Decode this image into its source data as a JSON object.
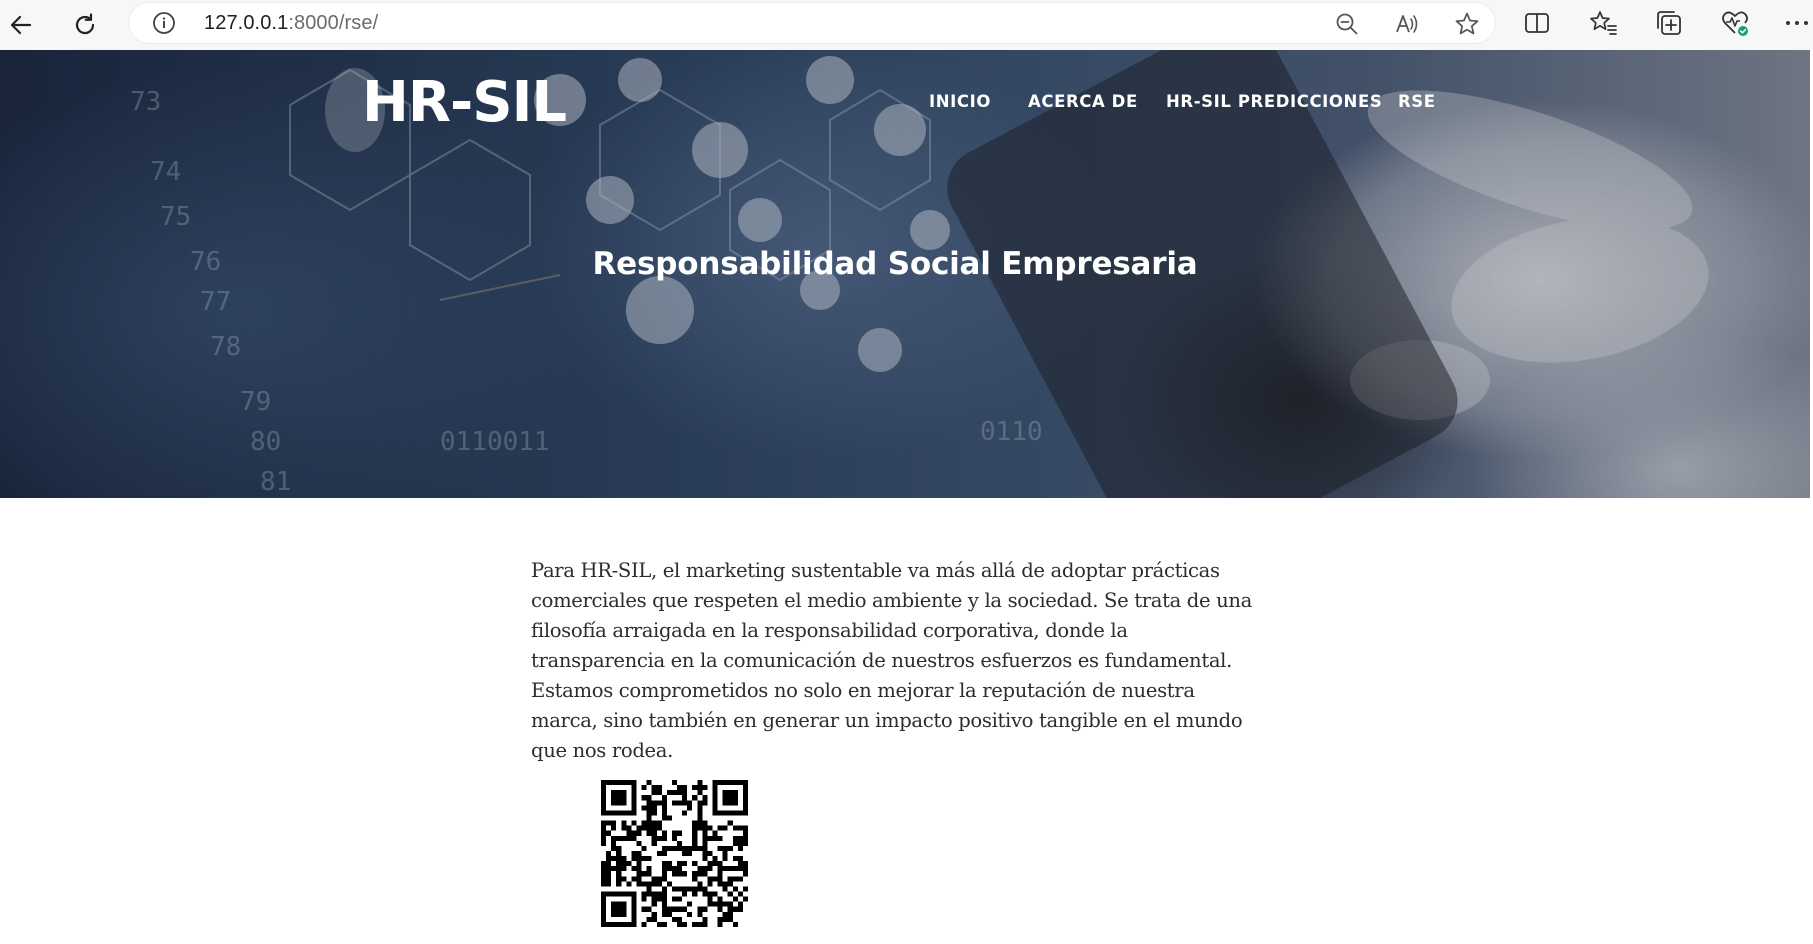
{
  "browser": {
    "url_host": "127.0.0.1",
    "url_path": ":8000/rse/",
    "icons": [
      "back-icon",
      "refresh-icon",
      "info-icon",
      "zoom-out-icon",
      "read-aloud-icon",
      "favorite-star-icon",
      "split-screen-icon",
      "favorites-icon",
      "collections-icon",
      "browser-essentials-icon",
      "more-options-icon"
    ]
  },
  "site": {
    "brand": "HR-SIL",
    "nav": [
      {
        "label": "INICIO"
      },
      {
        "label": "ACERCA DE"
      },
      {
        "label": "HR-SIL PREDICCIONES"
      },
      {
        "label": "RSE"
      }
    ]
  },
  "hero": {
    "title": "Responsabilidad Social Empresaria"
  },
  "content": {
    "paragraph": "Para HR-SIL, el marketing sustentable va más allá de adoptar prácticas comerciales que respeten el medio ambiente y la sociedad. Se trata de una filosofía arraigada en la responsabilidad corporativa, donde la transparencia en la comunicación de nuestros esfuerzos es fundamental. Estamos comprometidos no solo en mejorar la reputación de nuestra marca, sino también en generar un impacto positivo tangible en el mundo que nos rodea."
  },
  "colors": {
    "hero_text": "#ffffff",
    "body_text": "#2d2d2d",
    "chrome_bg": "#f7f7f7",
    "essentials_badge": "#1aa260"
  }
}
